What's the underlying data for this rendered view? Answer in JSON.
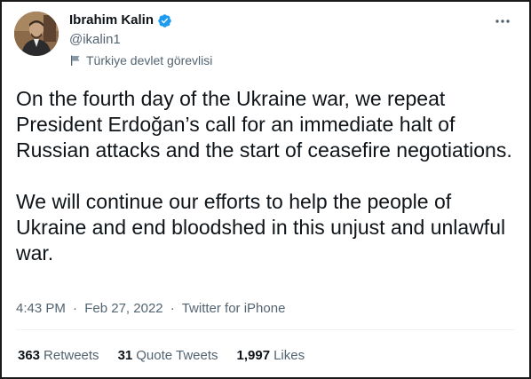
{
  "author": {
    "name": "Ibrahim Kalin",
    "handle": "@ikalin1",
    "label": "Türkiye devlet görevlisi",
    "verified": true,
    "avatar": "profile-photo"
  },
  "tweet": {
    "paragraphs": [
      "On the fourth day of the Ukraine war, we repeat President Erdoğan’s call for an immediate halt of Russian attacks and the start of ceasefire negotiations.",
      "We will continue our efforts to help the people of Ukraine and end bloodshed in this unjust and unlawful war."
    ],
    "time": "4:43 PM",
    "date": "Feb 27, 2022",
    "source": "Twitter for iPhone",
    "separator": "·"
  },
  "stats": {
    "retweets": {
      "count": "363",
      "label": "Retweets"
    },
    "quote_tweets": {
      "count": "31",
      "label": "Quote Tweets"
    },
    "likes": {
      "count": "1,997",
      "label": "Likes"
    }
  },
  "colors": {
    "text": "#0f1419",
    "secondary": "#536471",
    "verified": "#1d9bf0",
    "border": "#1a1a1a"
  },
  "icons": {
    "verified": "verified-badge-icon",
    "label": "flag-icon",
    "more": "more-options-icon"
  }
}
